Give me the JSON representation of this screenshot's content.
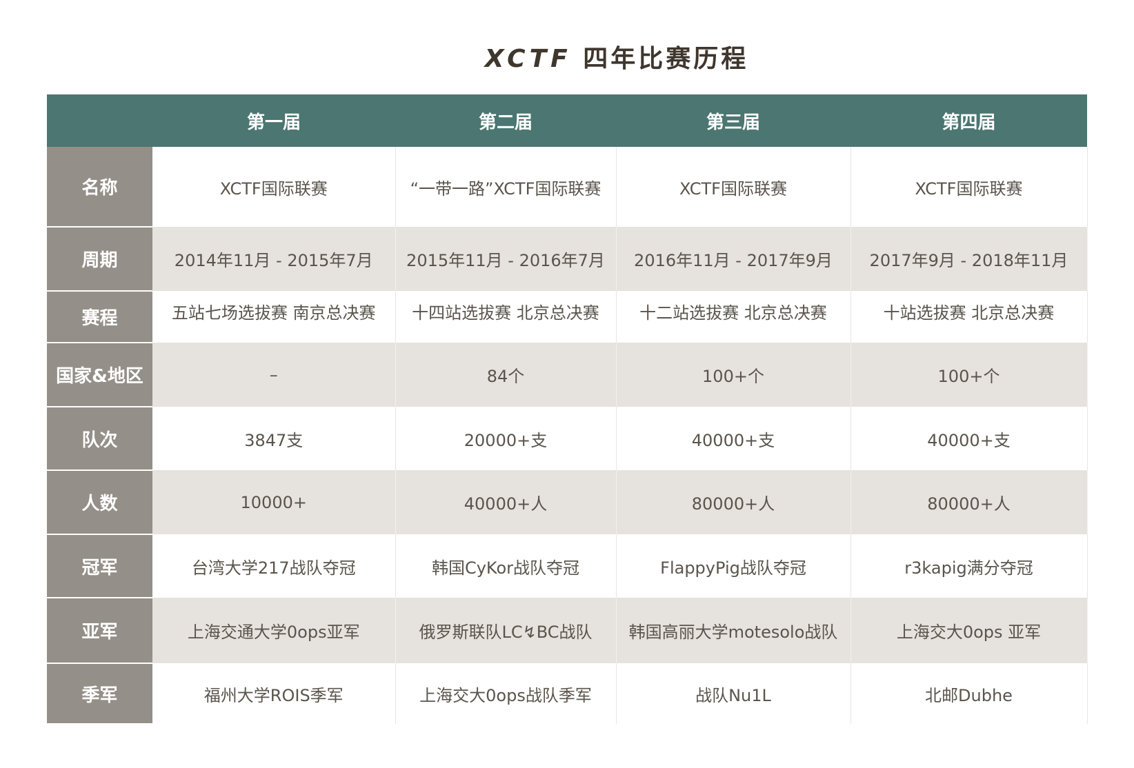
{
  "title_latin": "XCTF",
  "title_cn": "四年比赛历程",
  "columns": [
    "第一届",
    "第二届",
    "第三届",
    "第四届"
  ],
  "rows": [
    {
      "label": "名称",
      "cells": [
        "XCTF国际联赛",
        "“一带一路”XCTF国际联赛",
        "XCTF国际联赛",
        "XCTF国际联赛"
      ]
    },
    {
      "label": "周期",
      "cells": [
        "2014年11月 - 2015年7月",
        "2015年11月 - 2016年7月",
        "2016年11月 - 2017年9月",
        "2017年9月 - 2018年11月"
      ]
    },
    {
      "label": "赛程",
      "cells": [
        "五站七场选拔赛 南京总决赛",
        "十四站选拔赛 北京总决赛",
        "十二站选拔赛 北京总决赛",
        "十站选拔赛  北京总决赛"
      ]
    },
    {
      "label": "国家&地区",
      "cells": [
        "–",
        "84个",
        "100+个",
        "100+个"
      ]
    },
    {
      "label": "队次",
      "cells": [
        "3847支",
        "20000+支",
        "40000+支",
        "40000+支"
      ]
    },
    {
      "label": "人数",
      "cells": [
        "10000+",
        "40000+人",
        "80000+人",
        "80000+人"
      ]
    },
    {
      "label": "冠军",
      "cells": [
        "台湾大学217战队夺冠",
        "韩国CyKor战队夺冠",
        "FlappyPig战队夺冠",
        "r3kapig满分夺冠"
      ]
    },
    {
      "label": "亚军",
      "cells": [
        "上海交通大学0ops亚军",
        "俄罗斯联队LC↯BC战队",
        "韩国高丽大学motesolo战队",
        "上海交大0ops 亚军"
      ]
    },
    {
      "label": "季军",
      "cells": [
        "福州大学ROIS季军",
        "上海交大0ops战队季军",
        "战队Nu1L",
        "北邮Dubhe"
      ]
    }
  ]
}
